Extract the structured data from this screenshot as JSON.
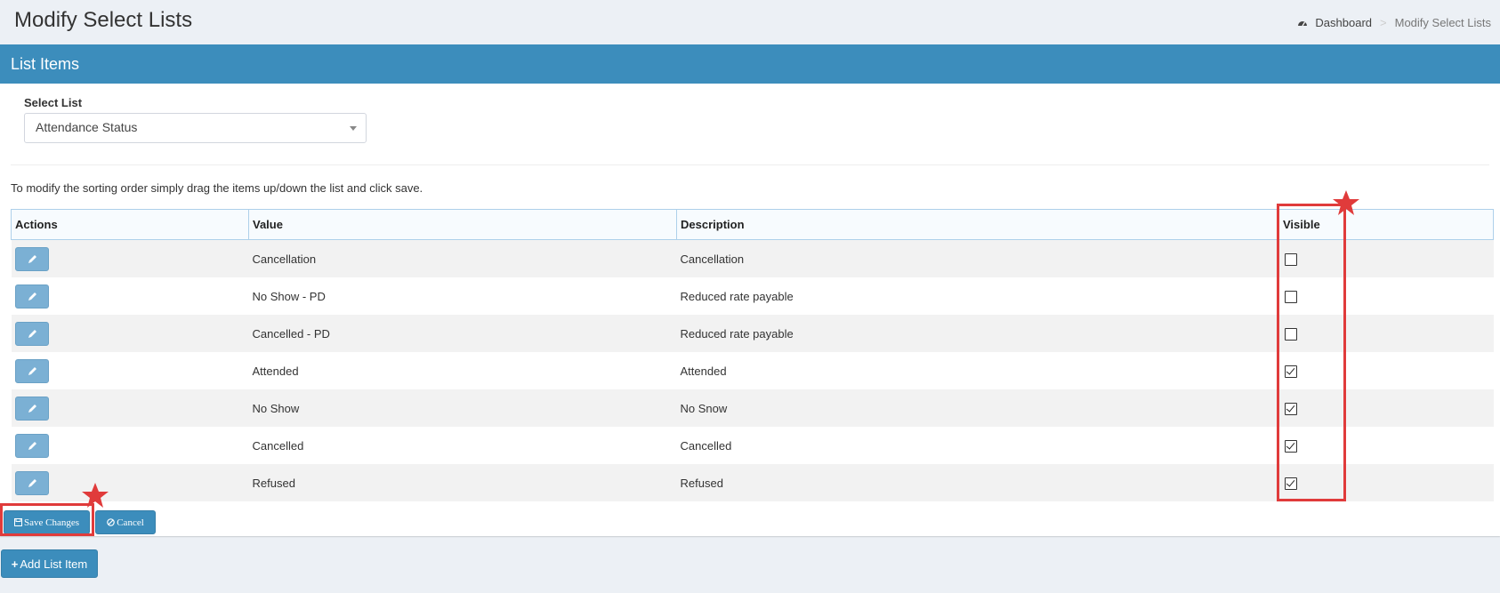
{
  "header": {
    "title": "Modify Select Lists",
    "breadcrumb": {
      "home": "Dashboard",
      "current": "Modify Select Lists"
    }
  },
  "box": {
    "title": "List Items",
    "select_label": "Select List",
    "selected_list": "Attendance Status",
    "instructions": "To modify the sorting order simply drag the items up/down the list and click save."
  },
  "table": {
    "columns": [
      "Actions",
      "Value",
      "Description",
      "Visible"
    ],
    "rows": [
      {
        "value": "Cancellation",
        "description": "Cancellation",
        "visible": false
      },
      {
        "value": "No Show - PD",
        "description": "Reduced rate payable",
        "visible": false
      },
      {
        "value": "Cancelled - PD",
        "description": "Reduced rate payable",
        "visible": false
      },
      {
        "value": "Attended",
        "description": "Attended",
        "visible": true
      },
      {
        "value": "No Show",
        "description": "No Snow",
        "visible": true
      },
      {
        "value": "Cancelled",
        "description": "Cancelled",
        "visible": true
      },
      {
        "value": "Refused",
        "description": "Refused",
        "visible": true
      }
    ]
  },
  "buttons": {
    "save": "Save Changes",
    "cancel": "Cancel",
    "add": "Add List Item"
  },
  "colors": {
    "primary": "#3c8dbc",
    "edit_button": "#7bb0d4",
    "annotation_red": "#e03b3b"
  }
}
